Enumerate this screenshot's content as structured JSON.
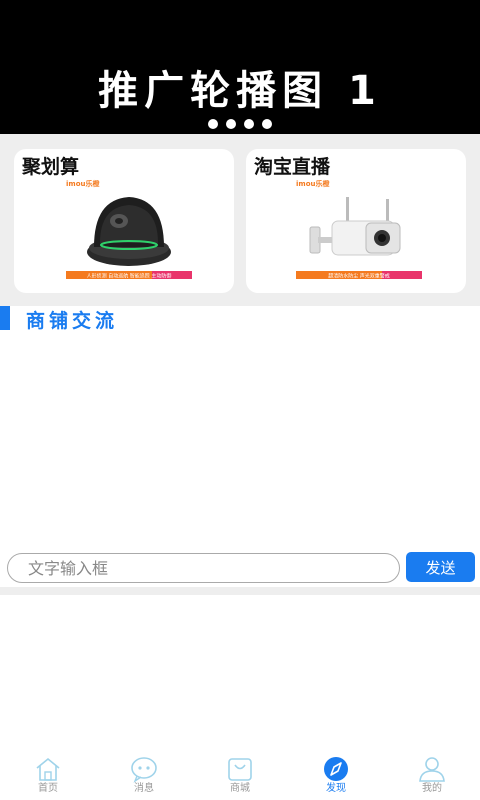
{
  "banner": {
    "title": "推广轮播图 1",
    "dot_count": 4
  },
  "promo_cards": [
    {
      "title": "聚划算",
      "brand": "imou乐橙",
      "tagline": "人形侦测  自动巡航  智能追踪  主动防御"
    },
    {
      "title": "淘宝直播",
      "brand": "imou乐橙",
      "tagline": "超清防水防尘  声光双重警戒"
    }
  ],
  "section": {
    "title": "商铺交流"
  },
  "chat": {
    "input_placeholder": "文字输入框",
    "send_label": "发送"
  },
  "nav": {
    "items": [
      {
        "label": "首页",
        "icon": "home-icon",
        "active": false
      },
      {
        "label": "消息",
        "icon": "message-icon",
        "active": false
      },
      {
        "label": "商城",
        "icon": "shop-bag-icon",
        "active": false
      },
      {
        "label": "发现",
        "icon": "compass-icon",
        "active": true
      },
      {
        "label": "我的",
        "icon": "user-icon",
        "active": false
      }
    ]
  },
  "colors": {
    "accent": "#1a7cf0",
    "inactive_nav": "#9fd3ea",
    "promo_tag_orange": "#f47a1f",
    "promo_tag_pink": "#e9346b"
  }
}
